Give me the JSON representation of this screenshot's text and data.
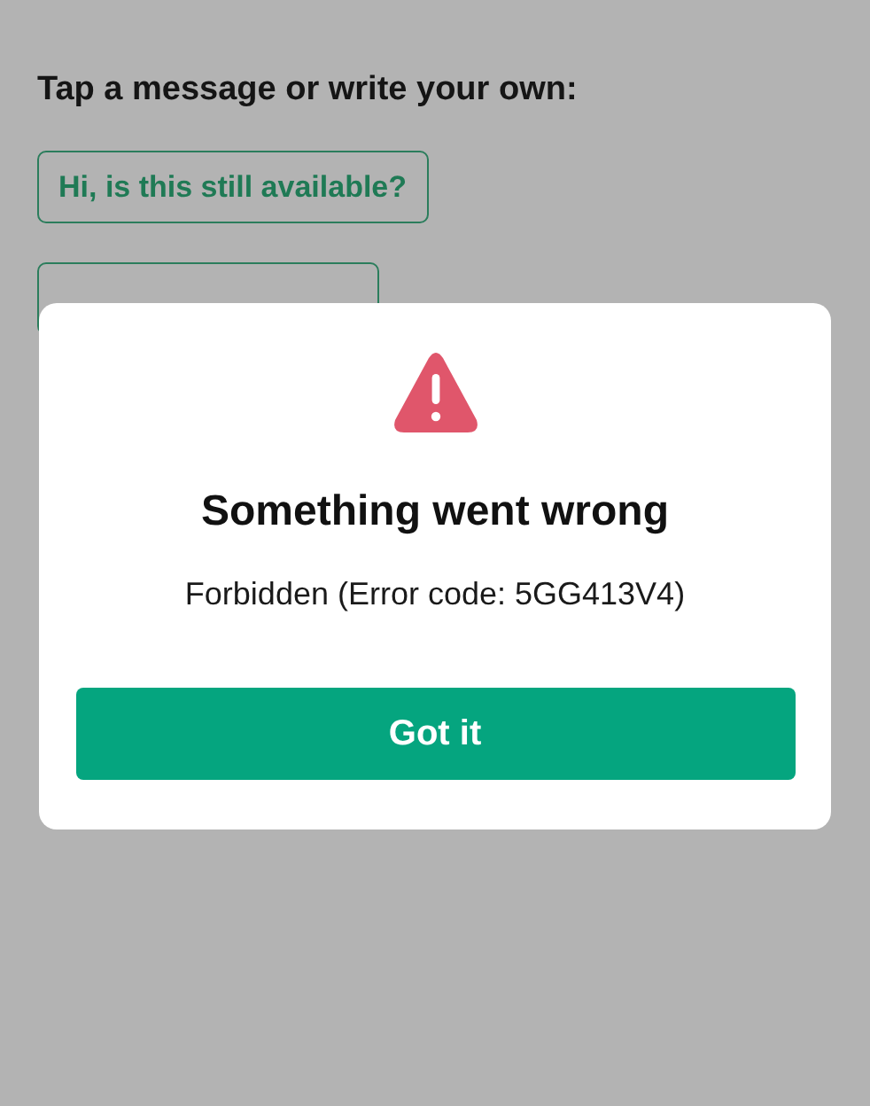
{
  "prompt": "Tap a message or write your own:",
  "quick_replies": [
    {
      "kind": "text",
      "label": "Hi, is this still available?"
    },
    {
      "kind": "covered"
    }
  ],
  "dialog": {
    "title": "Something went wrong",
    "message": "Forbidden (Error code: 5GG413V4)",
    "button": "Got it"
  }
}
